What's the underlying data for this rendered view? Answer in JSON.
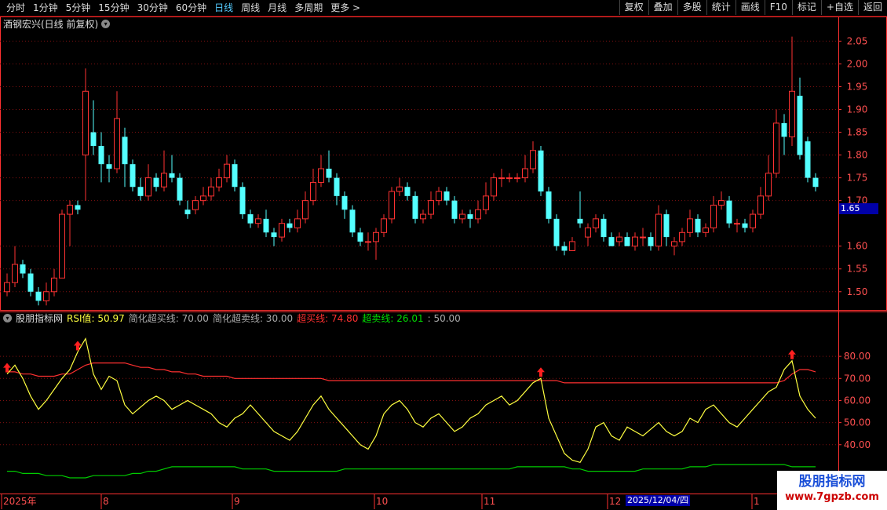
{
  "toolbar": {
    "left_items": [
      "分时",
      "1分钟",
      "5分钟",
      "15分钟",
      "30分钟",
      "60分钟",
      "日线",
      "周线",
      "月线",
      "多周期",
      "更多 >"
    ],
    "active_item": "日线",
    "right_items": [
      "复权",
      "叠加",
      "多股",
      "统计",
      "画线",
      "F10",
      "标记",
      "+自选",
      "返回"
    ]
  },
  "main_chart": {
    "title": "酒钢宏兴(日线 前复权)",
    "price_axis": [
      "2.05",
      "2.00",
      "1.95",
      "1.90",
      "1.85",
      "1.80",
      "1.75",
      "1.70",
      "1.60",
      "1.55",
      "1.50"
    ],
    "current_price": "1.65"
  },
  "rsi_panel": {
    "name": "股朋指标网",
    "rsi_label": "RSI值: 50.97",
    "simple_overbought": "简化超买线: 70.00",
    "simple_oversold": "简化超卖线: 30.00",
    "overbought_label": "超买线: 74.80",
    "oversold_label": "超卖线: 26.01",
    "mid_label": ": 50.00",
    "axis": [
      "80.00",
      "70.00",
      "60.00",
      "50.00",
      "40.00"
    ]
  },
  "date_axis": {
    "labels": [
      "2025年",
      "8",
      "9",
      "10",
      "11",
      "12",
      "1"
    ],
    "cursor_date": "2025/12/04/四"
  },
  "watermark": {
    "line1": "股朋指标网",
    "line2": "www.7gpzb.com"
  },
  "colors": {
    "up": "#ff3232",
    "down": "#54ffff",
    "rsi": "#ffff40",
    "overbought": "#ff3030",
    "oversold": "#00cc00",
    "axis": "#ff3030",
    "grid": "#801010"
  },
  "chart_data": {
    "type": "candlestick",
    "price_range": [
      1.46,
      2.08
    ],
    "candles": [
      [
        1.5,
        1.52,
        1.54,
        1.49
      ],
      [
        1.52,
        1.56,
        1.6,
        1.51
      ],
      [
        1.56,
        1.54,
        1.57,
        1.53
      ],
      [
        1.54,
        1.5,
        1.55,
        1.49
      ],
      [
        1.5,
        1.48,
        1.51,
        1.47
      ],
      [
        1.48,
        1.5,
        1.52,
        1.47
      ],
      [
        1.5,
        1.53,
        1.55,
        1.49
      ],
      [
        1.53,
        1.67,
        1.68,
        1.53
      ],
      [
        1.67,
        1.69,
        1.7,
        1.6
      ],
      [
        1.69,
        1.68,
        1.7,
        1.67
      ],
      [
        1.8,
        1.94,
        1.99,
        1.7
      ],
      [
        1.85,
        1.82,
        1.92,
        1.8
      ],
      [
        1.82,
        1.78,
        1.85,
        1.74
      ],
      [
        1.78,
        1.77,
        1.8,
        1.74
      ],
      [
        1.77,
        1.88,
        1.94,
        1.76
      ],
      [
        1.84,
        1.78,
        1.86,
        1.73
      ],
      [
        1.78,
        1.73,
        1.79,
        1.72
      ],
      [
        1.73,
        1.71,
        1.75,
        1.7
      ],
      [
        1.71,
        1.75,
        1.78,
        1.7
      ],
      [
        1.75,
        1.73,
        1.76,
        1.72
      ],
      [
        1.73,
        1.76,
        1.81,
        1.72
      ],
      [
        1.76,
        1.75,
        1.8,
        1.74
      ],
      [
        1.75,
        1.7,
        1.76,
        1.69
      ],
      [
        1.68,
        1.67,
        1.7,
        1.66
      ],
      [
        1.68,
        1.7,
        1.71,
        1.67
      ],
      [
        1.7,
        1.71,
        1.73,
        1.69
      ],
      [
        1.71,
        1.73,
        1.75,
        1.7
      ],
      [
        1.73,
        1.75,
        1.77,
        1.72
      ],
      [
        1.75,
        1.78,
        1.8,
        1.74
      ],
      [
        1.78,
        1.73,
        1.79,
        1.72
      ],
      [
        1.73,
        1.67,
        1.74,
        1.66
      ],
      [
        1.67,
        1.65,
        1.68,
        1.64
      ],
      [
        1.65,
        1.66,
        1.67,
        1.64
      ],
      [
        1.66,
        1.63,
        1.68,
        1.62
      ],
      [
        1.63,
        1.62,
        1.64,
        1.6
      ],
      [
        1.62,
        1.65,
        1.66,
        1.61
      ],
      [
        1.65,
        1.64,
        1.66,
        1.63
      ],
      [
        1.64,
        1.66,
        1.68,
        1.63
      ],
      [
        1.66,
        1.7,
        1.72,
        1.65
      ],
      [
        1.7,
        1.74,
        1.77,
        1.69
      ],
      [
        1.74,
        1.77,
        1.8,
        1.73
      ],
      [
        1.77,
        1.75,
        1.81,
        1.74
      ],
      [
        1.75,
        1.71,
        1.76,
        1.69
      ],
      [
        1.71,
        1.68,
        1.72,
        1.66
      ],
      [
        1.68,
        1.63,
        1.69,
        1.62
      ],
      [
        1.63,
        1.61,
        1.64,
        1.6
      ],
      [
        1.61,
        1.61,
        1.63,
        1.59
      ],
      [
        1.61,
        1.63,
        1.64,
        1.57
      ],
      [
        1.63,
        1.66,
        1.67,
        1.62
      ],
      [
        1.66,
        1.72,
        1.73,
        1.65
      ],
      [
        1.72,
        1.73,
        1.75,
        1.71
      ],
      [
        1.73,
        1.71,
        1.74,
        1.7
      ],
      [
        1.71,
        1.66,
        1.72,
        1.65
      ],
      [
        1.66,
        1.67,
        1.68,
        1.65
      ],
      [
        1.67,
        1.7,
        1.72,
        1.66
      ],
      [
        1.7,
        1.72,
        1.73,
        1.69
      ],
      [
        1.72,
        1.7,
        1.73,
        1.69
      ],
      [
        1.7,
        1.66,
        1.71,
        1.65
      ],
      [
        1.66,
        1.67,
        1.68,
        1.65
      ],
      [
        1.67,
        1.66,
        1.68,
        1.64
      ],
      [
        1.66,
        1.68,
        1.7,
        1.65
      ],
      [
        1.68,
        1.71,
        1.74,
        1.67
      ],
      [
        1.71,
        1.75,
        1.76,
        1.7
      ],
      [
        1.75,
        1.75,
        1.77,
        1.73
      ],
      [
        1.75,
        1.75,
        1.76,
        1.74
      ],
      [
        1.75,
        1.75,
        1.76,
        1.74
      ],
      [
        1.75,
        1.77,
        1.8,
        1.74
      ],
      [
        1.77,
        1.81,
        1.83,
        1.76
      ],
      [
        1.81,
        1.72,
        1.82,
        1.71
      ],
      [
        1.72,
        1.66,
        1.73,
        1.65
      ],
      [
        1.66,
        1.6,
        1.67,
        1.59
      ],
      [
        1.6,
        1.59,
        1.61,
        1.58
      ],
      [
        1.59,
        1.61,
        1.62,
        1.59
      ],
      [
        1.66,
        1.65,
        1.72,
        1.64
      ],
      [
        1.62,
        1.64,
        1.65,
        1.6
      ],
      [
        1.64,
        1.66,
        1.67,
        1.63
      ],
      [
        1.66,
        1.62,
        1.67,
        1.61
      ],
      [
        1.62,
        1.6,
        1.63,
        1.6
      ],
      [
        1.61,
        1.62,
        1.63,
        1.6
      ],
      [
        1.62,
        1.6,
        1.63,
        1.6
      ],
      [
        1.6,
        1.62,
        1.63,
        1.59
      ],
      [
        1.62,
        1.62,
        1.64,
        1.6
      ],
      [
        1.62,
        1.6,
        1.63,
        1.59
      ],
      [
        1.6,
        1.67,
        1.69,
        1.59
      ],
      [
        1.67,
        1.62,
        1.68,
        1.6
      ],
      [
        1.6,
        1.61,
        1.62,
        1.58
      ],
      [
        1.61,
        1.63,
        1.64,
        1.6
      ],
      [
        1.63,
        1.66,
        1.68,
        1.62
      ],
      [
        1.66,
        1.63,
        1.67,
        1.62
      ],
      [
        1.63,
        1.64,
        1.65,
        1.62
      ],
      [
        1.64,
        1.69,
        1.71,
        1.63
      ],
      [
        1.69,
        1.7,
        1.72,
        1.68
      ],
      [
        1.7,
        1.65,
        1.71,
        1.64
      ],
      [
        1.65,
        1.65,
        1.66,
        1.63
      ],
      [
        1.65,
        1.64,
        1.66,
        1.63
      ],
      [
        1.64,
        1.67,
        1.68,
        1.63
      ],
      [
        1.67,
        1.71,
        1.73,
        1.66
      ],
      [
        1.71,
        1.76,
        1.8,
        1.7
      ],
      [
        1.76,
        1.87,
        1.9,
        1.75
      ],
      [
        1.87,
        1.84,
        1.89,
        1.8
      ],
      [
        1.84,
        1.94,
        2.06,
        1.82
      ],
      [
        1.93,
        1.8,
        1.97,
        1.79
      ],
      [
        1.83,
        1.75,
        1.84,
        1.74
      ],
      [
        1.75,
        1.73,
        1.76,
        1.72
      ]
    ],
    "rsi": [
      72,
      76,
      70,
      62,
      56,
      60,
      65,
      70,
      74,
      82,
      88,
      72,
      65,
      71,
      69,
      58,
      54,
      57,
      60,
      62,
      60,
      56,
      58,
      60,
      58,
      56,
      54,
      50,
      48,
      52,
      54,
      58,
      54,
      50,
      46,
      44,
      42,
      46,
      52,
      58,
      62,
      56,
      52,
      48,
      44,
      40,
      38,
      44,
      54,
      58,
      60,
      56,
      50,
      48,
      52,
      54,
      50,
      46,
      48,
      52,
      54,
      58,
      60,
      62,
      58,
      60,
      64,
      68,
      70,
      52,
      44,
      36,
      33,
      32,
      38,
      48,
      50,
      44,
      42,
      48,
      46,
      44,
      47,
      50,
      46,
      44,
      46,
      52,
      50,
      56,
      58,
      54,
      50,
      48,
      52,
      56,
      60,
      64,
      66,
      74,
      78,
      62,
      56,
      52
    ],
    "overbought_line": [
      73,
      73,
      72,
      72,
      71,
      71,
      71,
      72,
      72,
      74,
      76,
      77,
      77,
      77,
      77,
      77,
      76,
      75,
      75,
      74,
      74,
      73,
      73,
      72,
      72,
      71,
      71,
      71,
      71,
      70,
      70,
      70,
      70,
      70,
      70,
      70,
      70,
      70,
      70,
      70,
      70,
      69,
      69,
      69,
      69,
      69,
      69,
      69,
      69,
      69,
      69,
      69,
      69,
      69,
      69,
      69,
      69,
      69,
      69,
      69,
      69,
      69,
      69,
      69,
      69,
      69,
      69,
      69,
      69,
      69,
      69,
      68,
      68,
      68,
      68,
      68,
      68,
      68,
      68,
      68,
      68,
      68,
      68,
      68,
      68,
      68,
      68,
      68,
      68,
      68,
      68,
      68,
      68,
      68,
      68,
      68,
      68,
      68,
      68,
      69,
      72,
      74,
      74,
      73
    ],
    "oversold_line": [
      28,
      28,
      27,
      27,
      27,
      26,
      26,
      26,
      25,
      25,
      25,
      26,
      26,
      26,
      26,
      26,
      27,
      27,
      28,
      28,
      29,
      30,
      30,
      30,
      30,
      30,
      30,
      30,
      30,
      30,
      29,
      29,
      29,
      29,
      28,
      28,
      28,
      28,
      28,
      28,
      28,
      28,
      28,
      29,
      29,
      29,
      29,
      29,
      29,
      29,
      29,
      29,
      29,
      29,
      29,
      29,
      29,
      29,
      29,
      29,
      29,
      29,
      29,
      29,
      29,
      30,
      30,
      30,
      30,
      30,
      30,
      30,
      29,
      29,
      28,
      28,
      28,
      28,
      28,
      28,
      28,
      29,
      29,
      29,
      29,
      29,
      29,
      30,
      30,
      30,
      31,
      31,
      31,
      31,
      31,
      31,
      31,
      31,
      31,
      31,
      30,
      30,
      30,
      30
    ]
  }
}
